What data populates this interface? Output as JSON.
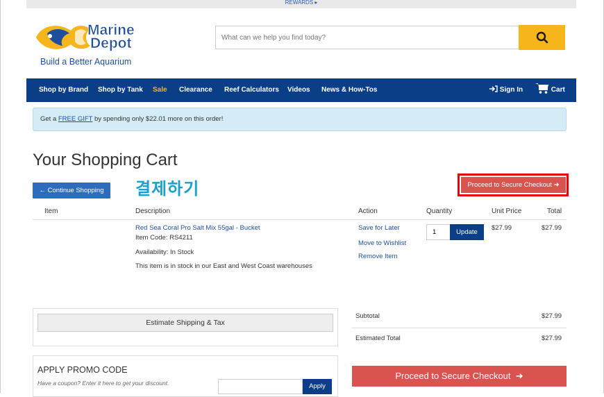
{
  "topbar": {
    "rewards_label": "REWARDS ▸"
  },
  "logo": {
    "word1": "Marine",
    "word2": "Depot",
    "tagline": "Build a Better Aquarium"
  },
  "search": {
    "placeholder": "What can we help you find today?",
    "icon": "search-icon"
  },
  "nav": {
    "items": [
      "Shop by Brand",
      "Shop by Tank",
      "Sale",
      "Clearance",
      "Reef Calculators",
      "Videos",
      "News & How-Tos"
    ],
    "sign_in": "Sign In",
    "cart": "Cart"
  },
  "gift_banner": {
    "prefix": "Get a ",
    "link": "FREE GIFT",
    "suffix": " by spending only $22.01 more on this order!"
  },
  "cart": {
    "title": "Your Shopping Cart",
    "continue_label": "Continue Shopping",
    "annotation": "결제하기",
    "checkout_label": "Proceed to Secure Checkout",
    "columns": {
      "item": "Item",
      "description": "Description",
      "action": "Action",
      "quantity": "Quantity",
      "unit_price": "Unit Price",
      "total": "Total"
    },
    "line": {
      "name": "Red Sea Coral Pro Salt Mix 55gal - Bucket",
      "code": "Item Code: RS4211",
      "availability": "Availability: In Stock",
      "stock_note": "This item is in stock in our East and West Coast warehouses",
      "save_for_later": "Save for Later",
      "move_to_wishlist": "Move to Wishlist",
      "remove": "Remove Item",
      "quantity": "1",
      "update_label": "Update",
      "unit_price": "$27.99",
      "total": "$27.99"
    }
  },
  "shipping": {
    "estimate_label": "Estimate Shipping & Tax"
  },
  "summary": {
    "subtotal_label": "Subtotal",
    "subtotal_value": "$27.99",
    "estimated_total_label": "Estimated Total",
    "estimated_total_value": "$27.99",
    "checkout_label": "Proceed to Secure Checkout"
  },
  "promo": {
    "title": "APPLY PROMO CODE",
    "hint": "Have a coupon? Enter it here to get your discount.",
    "apply_label": "Apply"
  },
  "colors": {
    "nav_blue": "#0a3f88",
    "accent_yellow": "#f5b51b",
    "checkout_red": "#d9534f",
    "link_blue": "#1f4e9a"
  }
}
